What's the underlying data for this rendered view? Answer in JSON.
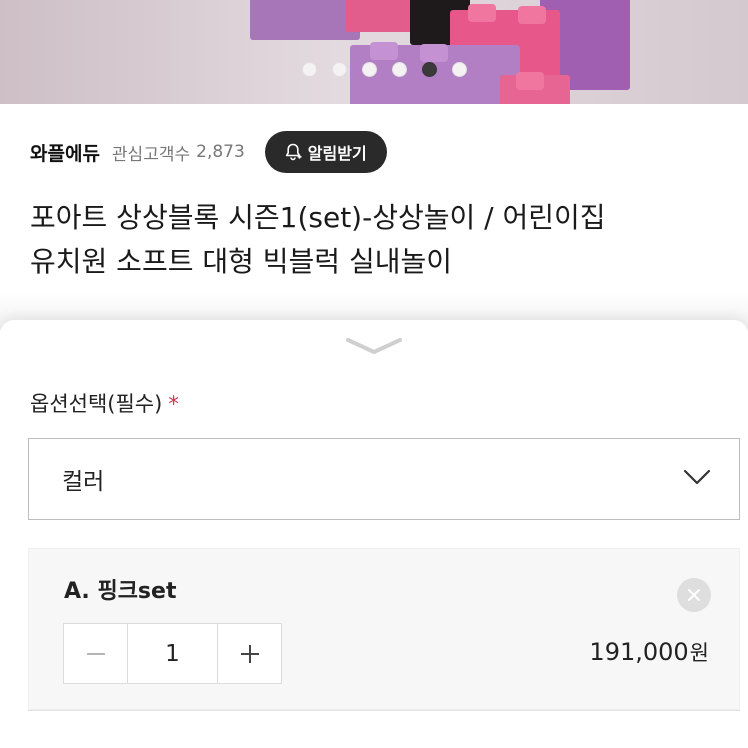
{
  "hero": {
    "carousel": {
      "count": 6,
      "active_index": 4
    }
  },
  "seller": {
    "name": "와플에듀",
    "followers_label": "관심고객수",
    "followers_count": "2,873",
    "notify_label": "알림받기",
    "notify_icon": "bell-plus-icon"
  },
  "product": {
    "title_line1": "포아트 상상블록 시즌1(set)-상상놀이 / 어린이집",
    "title_line2": "유치원 소프트 대형 빅블럭 실내놀이"
  },
  "sheet": {
    "handle_icon": "chevron-down-icon",
    "section_label": "옵션선택(필수)",
    "required_mark": "*",
    "select": {
      "value": "컬러",
      "icon": "chevron-down-icon"
    },
    "selected_option": {
      "name": "A. 핑크set",
      "quantity": "1",
      "price": "191,000",
      "price_unit": "원",
      "remove_icon": "close-icon",
      "minus_icon": "minus-icon",
      "plus_icon": "plus-icon"
    }
  },
  "colors": {
    "accent_total": "#c8264a",
    "required_star": "#d0334e",
    "notify_button_bg": "#2a2a2a"
  }
}
